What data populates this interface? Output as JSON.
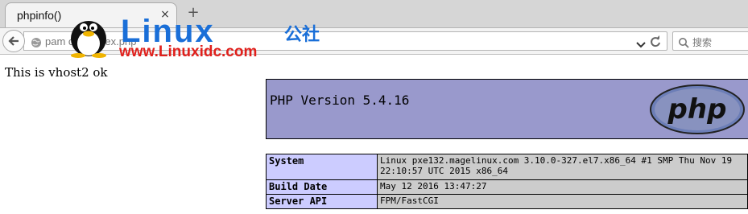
{
  "tab": {
    "title": "phpinfo()",
    "close": "×",
    "new_tab": "+"
  },
  "url_bar": {
    "url": "pam                      com/index.php"
  },
  "search_bar": {
    "placeholder": "搜索"
  },
  "watermark": {
    "brand": "Linux",
    "brand_cn": "公社",
    "site": "www.Linuxidc.com"
  },
  "page": {
    "vhost_text": "This is vhost2 ok",
    "php_version": "PHP Version 5.4.16",
    "php_logo_text": "php",
    "rows": [
      {
        "key": "System",
        "value": "Linux pxe132.magelinux.com 3.10.0-327.el7.x86_64 #1 SMP Thu Nov 19 22:10:57 UTC 2015 x86_64"
      },
      {
        "key": "Build Date",
        "value": "May 12 2016 13:47:27"
      },
      {
        "key": "Server API",
        "value": "FPM/FastCGI"
      }
    ]
  },
  "colors": {
    "php_header_bg": "#9999cc",
    "table_key_bg": "#ccccff",
    "table_value_bg": "#cccccc",
    "watermark_blue": "#1a6fd8",
    "watermark_red": "#e0201c"
  }
}
